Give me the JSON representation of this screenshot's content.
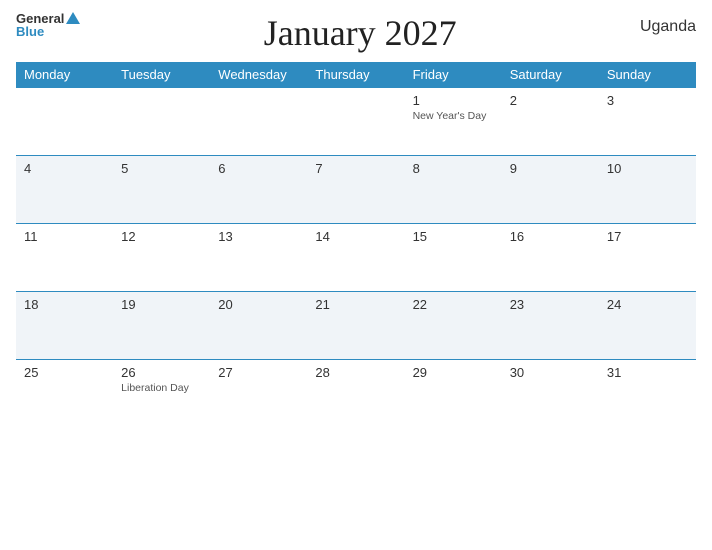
{
  "header": {
    "title": "January 2027",
    "country": "Uganda",
    "logo": {
      "general": "General",
      "blue": "Blue"
    }
  },
  "days_of_week": [
    "Monday",
    "Tuesday",
    "Wednesday",
    "Thursday",
    "Friday",
    "Saturday",
    "Sunday"
  ],
  "weeks": [
    [
      {
        "day": "",
        "holiday": ""
      },
      {
        "day": "",
        "holiday": ""
      },
      {
        "day": "",
        "holiday": ""
      },
      {
        "day": "",
        "holiday": ""
      },
      {
        "day": "1",
        "holiday": "New Year's Day"
      },
      {
        "day": "2",
        "holiday": ""
      },
      {
        "day": "3",
        "holiday": ""
      }
    ],
    [
      {
        "day": "4",
        "holiday": ""
      },
      {
        "day": "5",
        "holiday": ""
      },
      {
        "day": "6",
        "holiday": ""
      },
      {
        "day": "7",
        "holiday": ""
      },
      {
        "day": "8",
        "holiday": ""
      },
      {
        "day": "9",
        "holiday": ""
      },
      {
        "day": "10",
        "holiday": ""
      }
    ],
    [
      {
        "day": "11",
        "holiday": ""
      },
      {
        "day": "12",
        "holiday": ""
      },
      {
        "day": "13",
        "holiday": ""
      },
      {
        "day": "14",
        "holiday": ""
      },
      {
        "day": "15",
        "holiday": ""
      },
      {
        "day": "16",
        "holiday": ""
      },
      {
        "day": "17",
        "holiday": ""
      }
    ],
    [
      {
        "day": "18",
        "holiday": ""
      },
      {
        "day": "19",
        "holiday": ""
      },
      {
        "day": "20",
        "holiday": ""
      },
      {
        "day": "21",
        "holiday": ""
      },
      {
        "day": "22",
        "holiday": ""
      },
      {
        "day": "23",
        "holiday": ""
      },
      {
        "day": "24",
        "holiday": ""
      }
    ],
    [
      {
        "day": "25",
        "holiday": ""
      },
      {
        "day": "26",
        "holiday": "Liberation Day"
      },
      {
        "day": "27",
        "holiday": ""
      },
      {
        "day": "28",
        "holiday": ""
      },
      {
        "day": "29",
        "holiday": ""
      },
      {
        "day": "30",
        "holiday": ""
      },
      {
        "day": "31",
        "holiday": ""
      }
    ]
  ]
}
